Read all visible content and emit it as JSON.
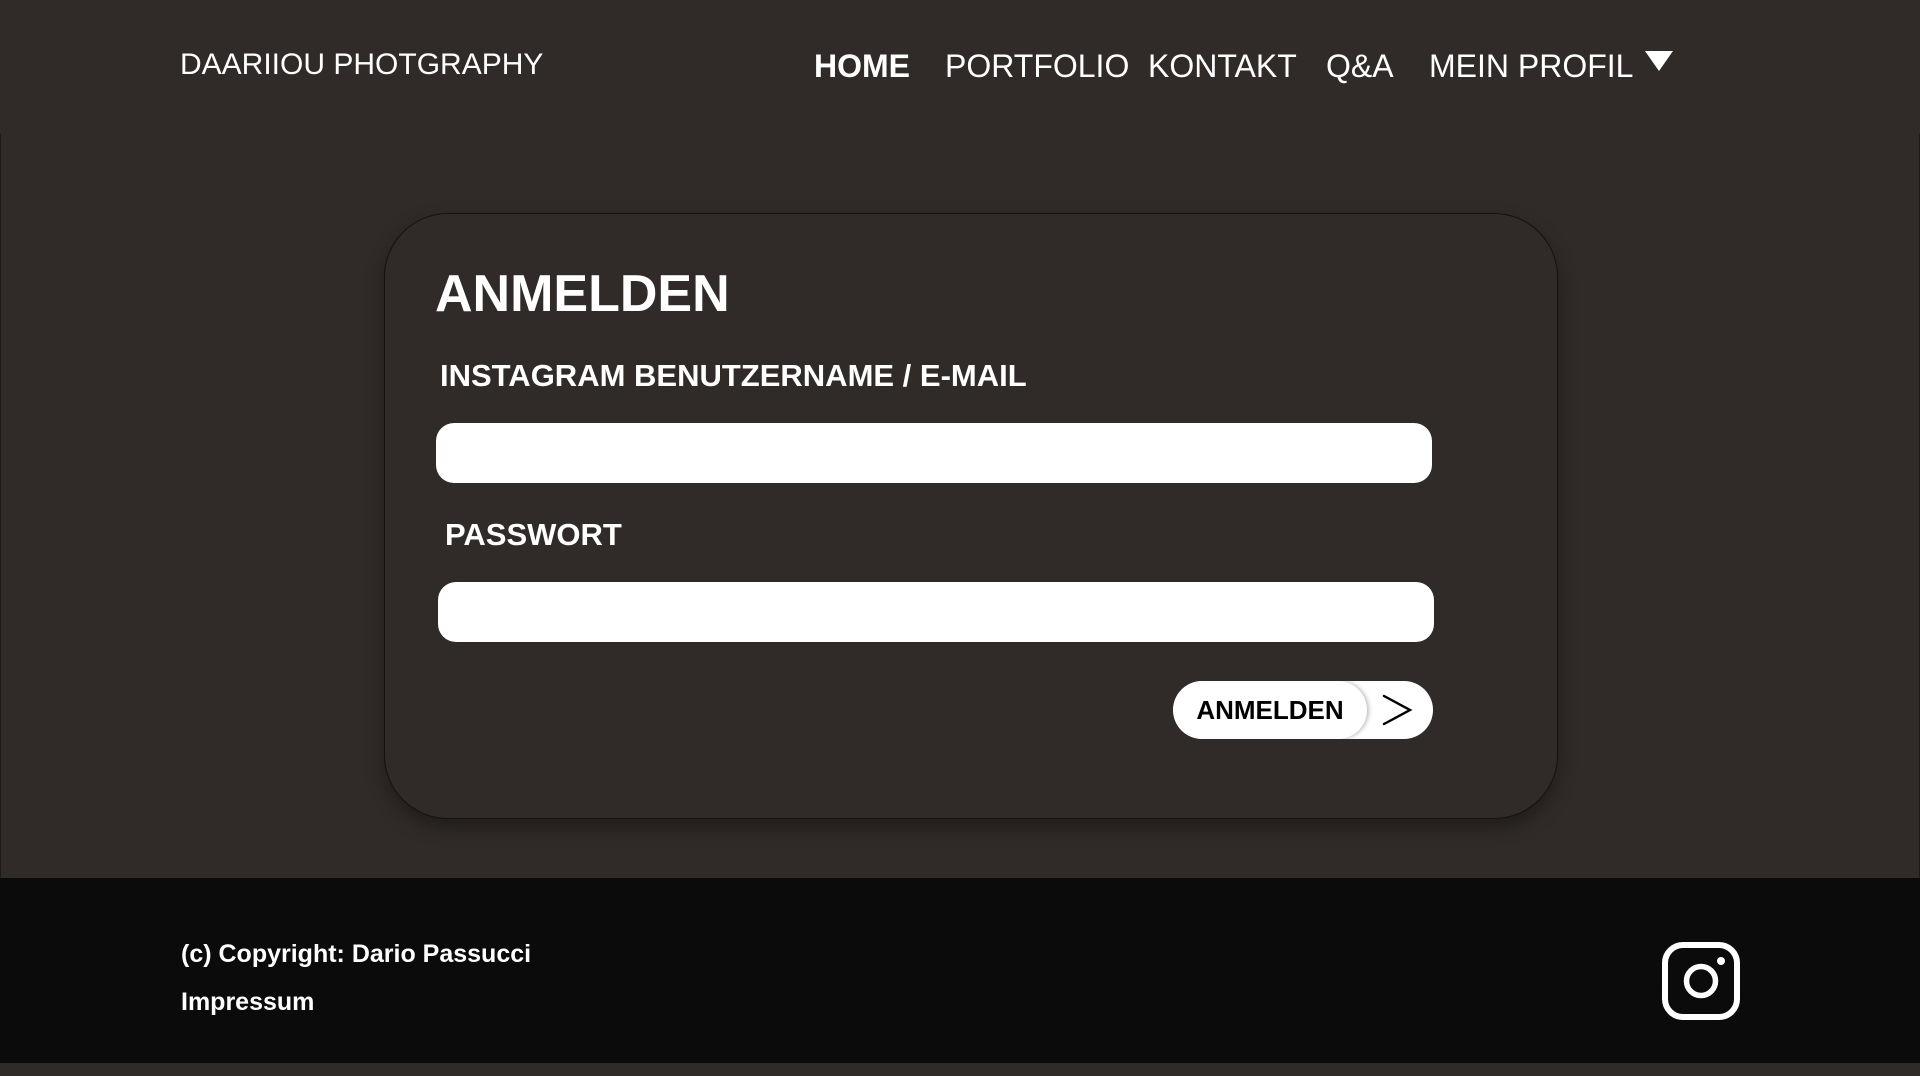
{
  "header": {
    "brand": "DAARIIOU PHOTGRAPHY",
    "nav": {
      "home": "HOME",
      "portfolio": "PORTFOLIO",
      "kontakt": "KONTAKT",
      "qa": "Q&A",
      "profil": "MEIN PROFIL"
    },
    "profil_icon": "caret-down-icon"
  },
  "login": {
    "title": "ANMELDEN",
    "username_label": "INSTAGRAM BENUTZERNAME / E-MAIL",
    "username_value": "",
    "password_label": "PASSWORT",
    "password_value": "",
    "submit_label": "ANMELDEN",
    "submit_icon": "chevron-right-icon"
  },
  "footer": {
    "copyright": "(c) Copyright: Dario Passucci",
    "impressum": "Impressum",
    "social_icon": "instagram-icon"
  },
  "colors": {
    "background": "#302b29",
    "footer": "#0b0b0b",
    "text": "#ffffff",
    "input": "#ffffff"
  }
}
